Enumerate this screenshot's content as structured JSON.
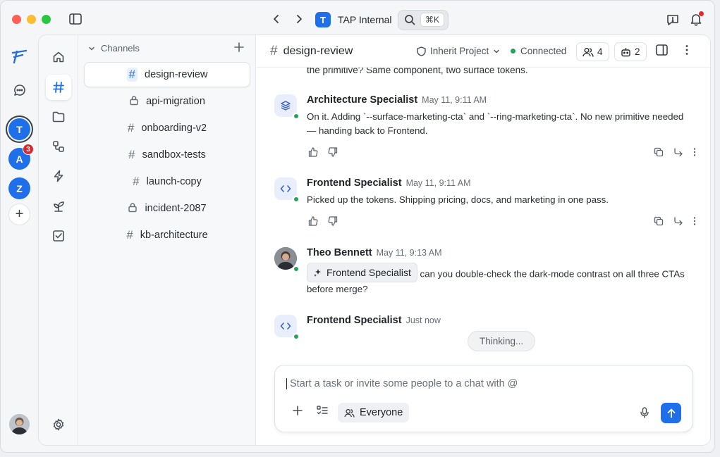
{
  "app": {
    "workspace_badge": "T",
    "workspace_name": "TAP Internal",
    "search_shortcut": "⌘K"
  },
  "rail": {
    "workspaces": [
      {
        "letter": "T",
        "active": true
      },
      {
        "letter": "A",
        "badge": "3"
      },
      {
        "letter": "Z"
      }
    ],
    "add_label": "+"
  },
  "channels": {
    "header": "Channels",
    "items": [
      {
        "name": "design-review",
        "icon": "hash",
        "active": true
      },
      {
        "name": "api-migration",
        "icon": "lock"
      },
      {
        "name": "onboarding-v2",
        "icon": "hash"
      },
      {
        "name": "sandbox-tests",
        "icon": "hash"
      },
      {
        "name": "launch-copy",
        "icon": "hash"
      },
      {
        "name": "incident-2087",
        "icon": "lock"
      },
      {
        "name": "kb-architecture",
        "icon": "hash"
      }
    ]
  },
  "chat": {
    "title": "design-review",
    "scope": "Inherit Project",
    "status": "Connected",
    "members_count": "4",
    "agents_count": "2",
    "partial_text": "the primitive? Same component, two surface tokens.",
    "messages": [
      {
        "author": "Architecture Specialist",
        "time": "May 11, 9:11 AM",
        "icon": "layers-icon",
        "text": "On it. Adding `--surface-marketing-cta` and `--ring-marketing-cta`. No new primitive needed — handing back to Frontend."
      },
      {
        "author": "Frontend Specialist",
        "time": "May 11, 9:11 AM",
        "icon": "code-icon",
        "text": "Picked up the tokens. Shipping pricing, docs, and marketing in one pass."
      },
      {
        "author": "Theo Bennett",
        "time": "May 11, 9:13 AM",
        "mention": "Frontend Specialist",
        "text": "can you double-check the dark-mode contrast on all three CTAs before merge?"
      },
      {
        "author": "Frontend Specialist",
        "time": "Just now",
        "icon": "code-icon",
        "status": "Thinking..."
      }
    ],
    "composer": {
      "placeholder": "Start a task or invite some people to a chat with @",
      "audience": "Everyone"
    }
  },
  "colors": {
    "accent": "#1f6feb",
    "online": "#22a559",
    "badge": "#d42a2f"
  }
}
